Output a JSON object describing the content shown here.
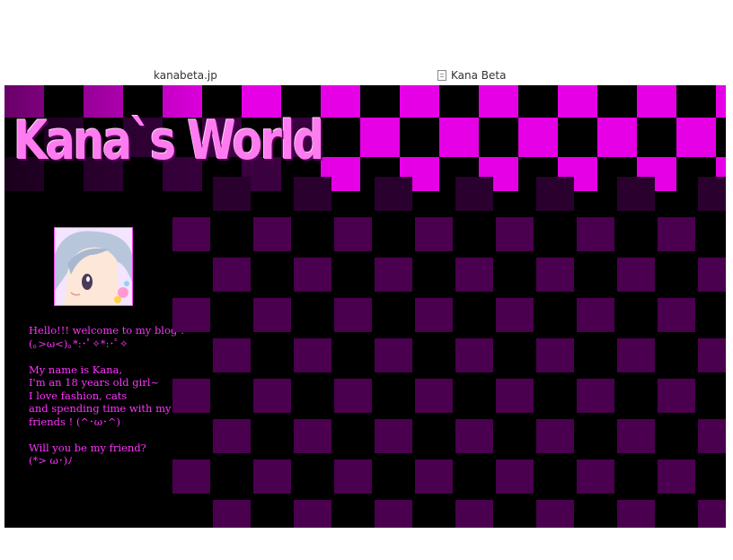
{
  "browser": {
    "url": "kanabeta.jp",
    "tab_title": "Kana Beta",
    "tab_icon": "page-icon"
  },
  "site": {
    "title": "Kana`s World",
    "accent_color": "#ee00ee",
    "text_color": "#ff33ff",
    "background": "#000000"
  },
  "sidebar": {
    "avatar_icon": "anime-girl-avatar",
    "bio": [
      "Hello!!! welcome to my blog !\n(｡>ω<)｡*:･ﾟ✧*:･ﾟ✧",
      "My name is Kana,\nI'm an 18 years old girl~\nI love fashion, cats\nand spending time with my\nfriends ! (^･ω･^)",
      "Will you be my friend?\n(*> ω･)ﾉ"
    ]
  }
}
